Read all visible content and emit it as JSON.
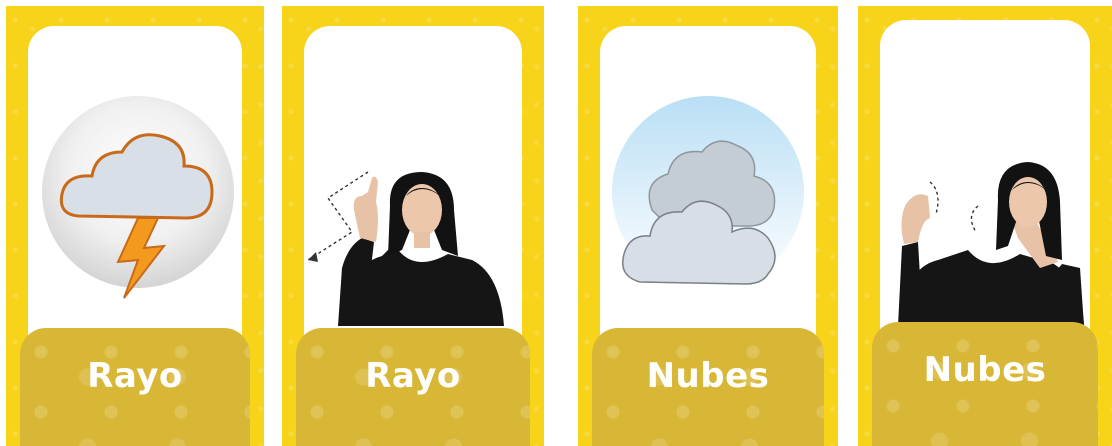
{
  "cards": [
    {
      "type": "icon",
      "icon": "thunder-cloud-icon",
      "label": "Rayo"
    },
    {
      "type": "photo",
      "icon": "sign-person",
      "label": "Rayo"
    },
    {
      "type": "icon",
      "icon": "clouds-icon",
      "label": "Nubes"
    },
    {
      "type": "photo",
      "icon": "sign-person",
      "label": "Nubes"
    }
  ],
  "colors": {
    "card_yellow": "#f7d31a",
    "label_band": "#d9b736",
    "bolt": "#f39a1e",
    "cloud": "#d7dde4"
  }
}
